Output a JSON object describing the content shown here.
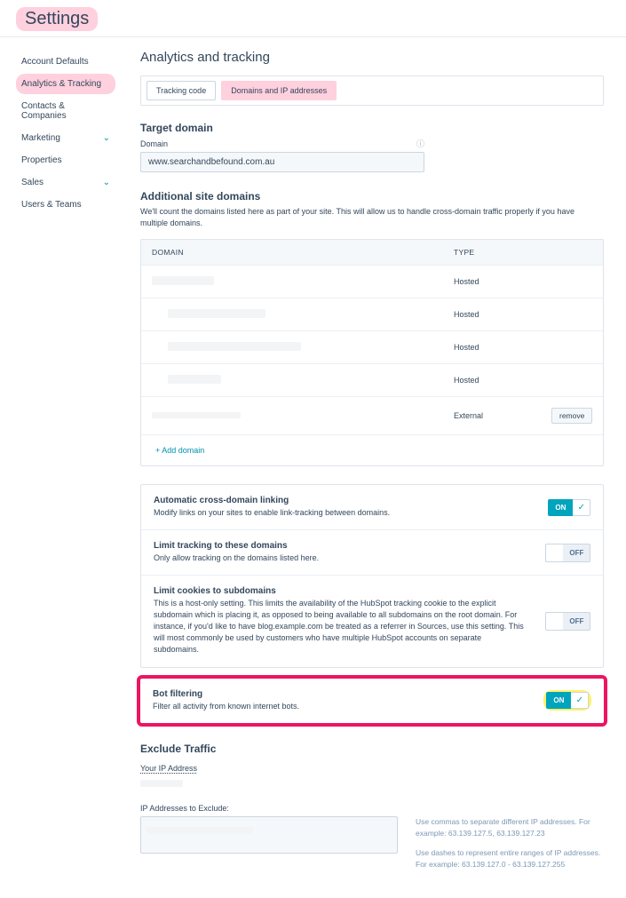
{
  "header": {
    "title": "Settings"
  },
  "sidebar": {
    "items": [
      {
        "label": "Account Defaults"
      },
      {
        "label": "Analytics & Tracking"
      },
      {
        "label": "Contacts & Companies"
      },
      {
        "label": "Marketing"
      },
      {
        "label": "Properties"
      },
      {
        "label": "Sales"
      },
      {
        "label": "Users & Teams"
      }
    ]
  },
  "page": {
    "title": "Analytics and tracking",
    "tabs": {
      "tracking": "Tracking code",
      "domains": "Domains and IP addresses"
    }
  },
  "target_domain": {
    "heading": "Target domain",
    "label": "Domain",
    "value": "www.searchandbefound.com.au"
  },
  "additional": {
    "heading": "Additional site domains",
    "desc": "We'll count the domains listed here as part of your site. This will allow us to handle cross-domain traffic properly if you have multiple domains.",
    "col_domain": "DOMAIN",
    "col_type": "TYPE",
    "rows": [
      {
        "type": "Hosted"
      },
      {
        "type": "Hosted"
      },
      {
        "type": "Hosted"
      },
      {
        "type": "Hosted"
      },
      {
        "type": "External"
      }
    ],
    "remove": "remove",
    "add": "+ Add domain"
  },
  "options": {
    "cross": {
      "title": "Automatic cross-domain linking",
      "desc": "Modify links on your sites to enable link-tracking between domains.",
      "state": "ON"
    },
    "limit_domains": {
      "title": "Limit tracking to these domains",
      "desc": "Only allow tracking on the domains listed here.",
      "state": "OFF"
    },
    "limit_cookies": {
      "title": "Limit cookies to subdomains",
      "desc": "This is a host-only setting. This limits the availability of the HubSpot tracking cookie to the explicit subdomain which is placing it, as opposed to being available to all subdomains on the root domain. For instance, if you'd like to have blog.example.com be treated as a referrer in Sources, use this setting. This will most commonly be used by customers who have multiple HubSpot accounts on separate subdomains.",
      "state": "OFF"
    },
    "bot": {
      "title": "Bot filtering",
      "desc": "Filter all activity from known internet bots.",
      "state": "ON"
    }
  },
  "exclude": {
    "heading": "Exclude Traffic",
    "your_ip_label": "Your IP Address",
    "ips_label": "IP Addresses to Exclude:",
    "help1": "Use commas to separate different IP addresses. For example: 63.139.127.5, 63.139.127.23",
    "help2": "Use dashes to represent entire ranges of IP addresses. For example: 63.139.127.0 - 63.139.127.255"
  },
  "labels": {
    "on": "ON",
    "off": "OFF"
  }
}
